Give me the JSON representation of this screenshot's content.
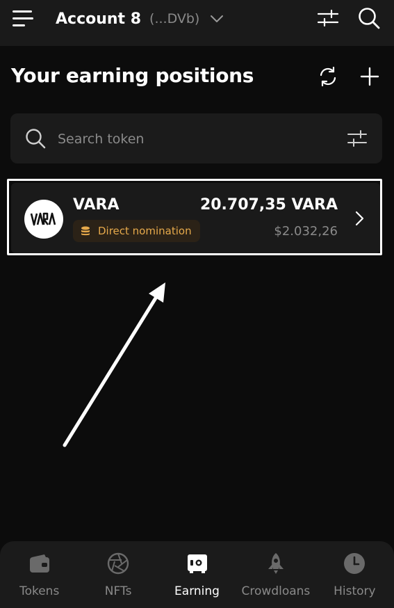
{
  "header": {
    "account_name": "Account 8",
    "account_address": "(...DVb)",
    "icons": [
      "menu-icon",
      "chevron-down-icon",
      "filter-icon",
      "search-icon"
    ]
  },
  "page": {
    "title": "Your earning positions",
    "icons": [
      "reload-icon",
      "add-icon"
    ]
  },
  "search": {
    "placeholder": "Search token",
    "value": ""
  },
  "positions": [
    {
      "token": "VARA",
      "method": "Direct nomination",
      "balance": "20.707,35 VARA",
      "value": "$2.032,26"
    }
  ],
  "bottom_nav": {
    "items": [
      {
        "label": "Tokens",
        "icon": "wallet-icon",
        "active": false
      },
      {
        "label": "NFTs",
        "icon": "aperture-icon",
        "active": false
      },
      {
        "label": "Earning",
        "icon": "safe-icon",
        "active": true
      },
      {
        "label": "Crowdloans",
        "icon": "rocket-icon",
        "active": false
      },
      {
        "label": "History",
        "icon": "clock-icon",
        "active": false
      }
    ]
  },
  "colors": {
    "background": "#0c0c0c",
    "surface": "#1a1a1a",
    "text_secondary": "#8a8a8a",
    "badge_text": "#e6a94b",
    "badge_background": "#2b2217",
    "active_nav": "#ffffff"
  }
}
